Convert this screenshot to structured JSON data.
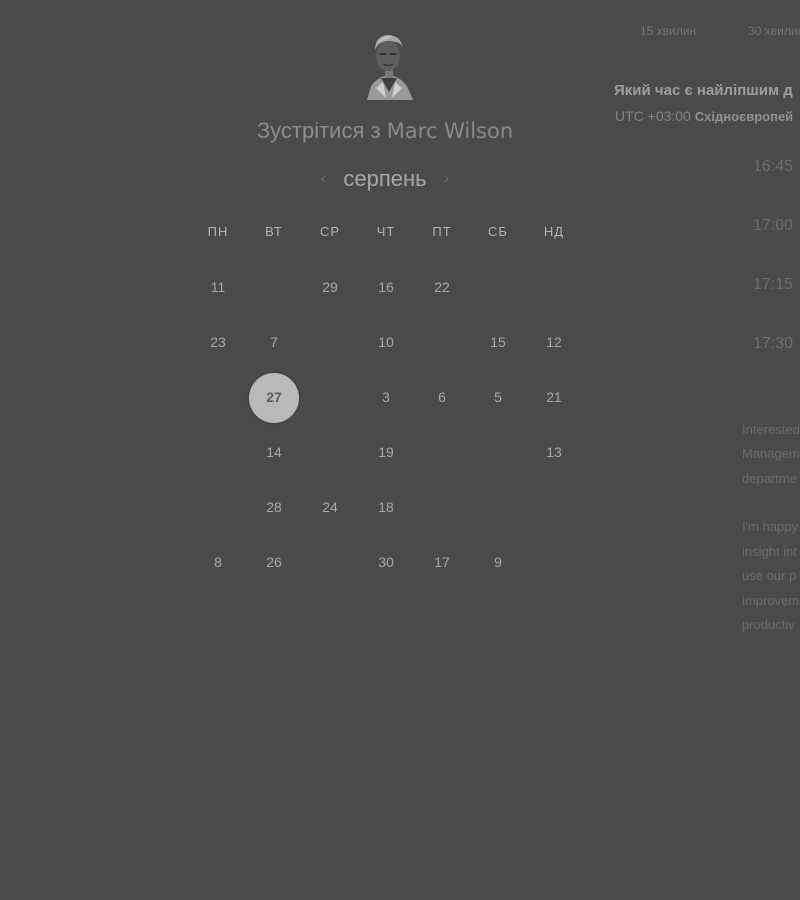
{
  "header": {
    "title_prefix": "Зустрітися з",
    "host_name": "Marc Wilson"
  },
  "calendar": {
    "month": "серпень",
    "prev_label": "‹",
    "next_label": "›",
    "weekdays": [
      "ПН",
      "ВТ",
      "СР",
      "ЧТ",
      "ПТ",
      "СБ",
      "НД"
    ],
    "weeks": [
      [
        "11",
        "",
        "29",
        "16",
        "22",
        "",
        ""
      ],
      [
        "23",
        "7",
        "",
        "10",
        "",
        "15",
        "12"
      ],
      [
        "",
        "27",
        "",
        "3",
        "6",
        "5",
        "21"
      ],
      [
        "",
        "14",
        "",
        "19",
        "",
        "",
        "13"
      ],
      [
        "",
        "28",
        "24",
        "18",
        "",
        "",
        ""
      ],
      [
        "8",
        "26",
        "",
        "30",
        "17",
        "9",
        ""
      ]
    ],
    "selected": "27"
  },
  "durations": [
    "15 хвилин",
    "30 хвилин"
  ],
  "question": "Який час є найліпшим д",
  "timezone": {
    "offset": "UTC +03:00",
    "name": "Східноєвропей"
  },
  "slots": [
    "16:45",
    "17:00",
    "17:15",
    "17:30"
  ],
  "bio": {
    "paragraph1": [
      "Interested",
      "Managem",
      "departme"
    ],
    "paragraph2": [
      "I'm happy",
      "insight int",
      "use our p",
      "improvem",
      "productiv"
    ]
  },
  "colors": {
    "background": "#4a4a4a",
    "selected_day": "#b9b9b9"
  }
}
